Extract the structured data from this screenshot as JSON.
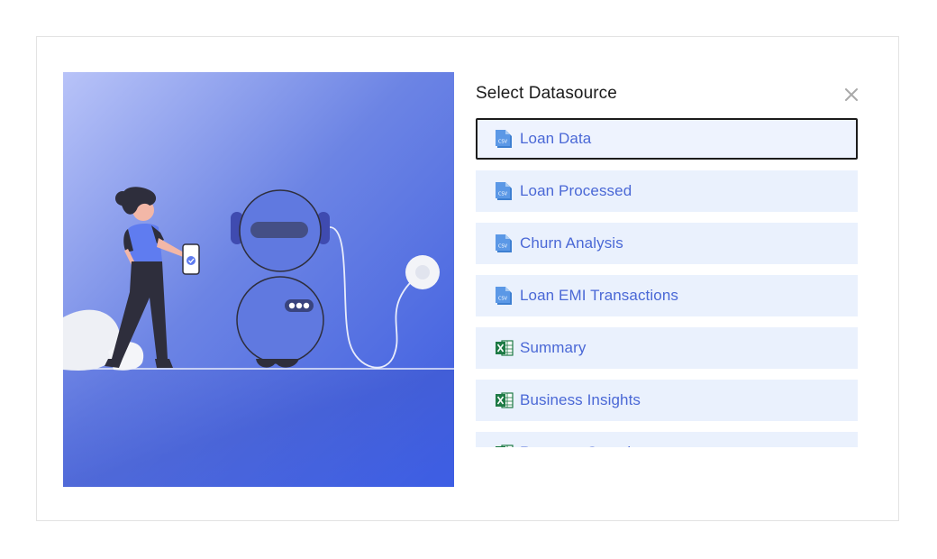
{
  "dialog": {
    "title": "Select Datasource",
    "close_icon": "close-icon"
  },
  "colors": {
    "accent_text": "#4a68d6",
    "item_bg": "#eaf1fd",
    "csv_icon": "#3d7fd1",
    "excel_icon": "#1e7a45",
    "illustration_gradient_start": "#b7c2f7",
    "illustration_gradient_end": "#3c5de0"
  },
  "datasources": [
    {
      "label": "Loan Data",
      "icon": "csv-file-icon",
      "selected": true
    },
    {
      "label": "Loan Processed",
      "icon": "csv-file-icon",
      "selected": false
    },
    {
      "label": "Churn Analysis",
      "icon": "csv-file-icon",
      "selected": false
    },
    {
      "label": "Loan EMI Transactions",
      "icon": "csv-file-icon",
      "selected": false
    },
    {
      "label": "Summary",
      "icon": "excel-file-icon",
      "selected": false
    },
    {
      "label": "Business Insights",
      "icon": "excel-file-icon",
      "selected": false
    },
    {
      "label": "Revenue Overview",
      "icon": "excel-file-icon",
      "selected": false
    }
  ]
}
